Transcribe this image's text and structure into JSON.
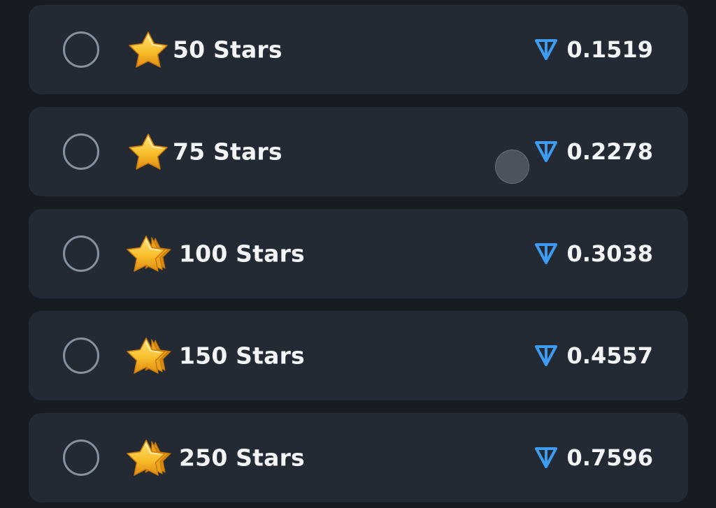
{
  "options": [
    {
      "label": "50 Stars",
      "price": "0.1519",
      "selected": false,
      "icon": "single-star-icon"
    },
    {
      "label": "75 Stars",
      "price": "0.2278",
      "selected": false,
      "icon": "single-star-icon"
    },
    {
      "label": "100 Stars",
      "price": "0.3038",
      "selected": false,
      "icon": "stacked-stars-icon"
    },
    {
      "label": "150 Stars",
      "price": "0.4557",
      "selected": false,
      "icon": "stacked-stars-icon"
    },
    {
      "label": "250 Stars",
      "price": "0.7596",
      "selected": false,
      "icon": "stacked-stars-icon"
    }
  ],
  "currency_icon": "ton-icon",
  "colors": {
    "background": "#181c22",
    "card": "#232a34",
    "radio_border": "#8792a0",
    "text": "#f3f4f6",
    "ton_blue": "#3d9bf0",
    "star_gold": "#f5b82a"
  }
}
